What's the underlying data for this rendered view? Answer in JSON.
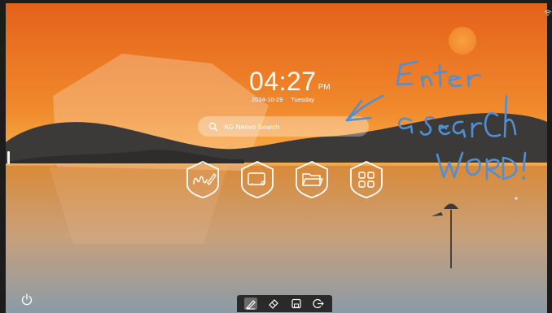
{
  "clock": {
    "time": "04:27",
    "ampm": "PM"
  },
  "date": {
    "value": "2024-10-29",
    "weekday": "Tuesday"
  },
  "search": {
    "placeholder": "AG Neovo Search"
  },
  "annotation": {
    "lines": [
      "Enter",
      "a search",
      "word!"
    ]
  },
  "apps": [
    {
      "icon": "whiteboard-icon"
    },
    {
      "icon": "screen-cast-icon"
    },
    {
      "icon": "folder-icon"
    },
    {
      "icon": "apps-grid-icon"
    }
  ],
  "toolbar": {
    "tools": [
      "pen-icon",
      "eraser-icon",
      "save-icon",
      "exit-icon"
    ],
    "active": "pen-icon"
  },
  "colors": {
    "sky_top": "#e6681a",
    "horizon": "#fbb24a",
    "water_bottom": "#8a9ba8",
    "ink": "#4f8fd8",
    "toolbar": "#2a2a2a"
  }
}
